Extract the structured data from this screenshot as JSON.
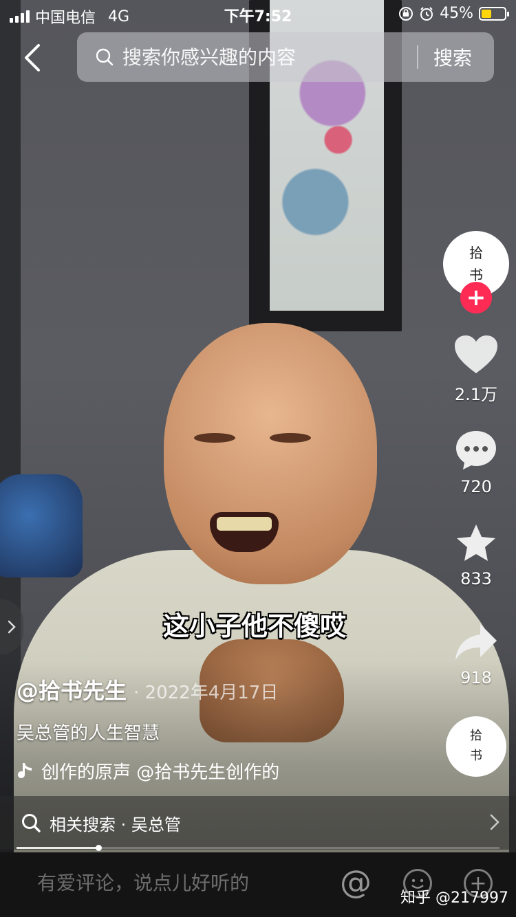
{
  "status_bar": {
    "carrier": "中国电信",
    "network": "4G",
    "time": "下午7:52",
    "battery_text": "45%",
    "battery_level": 0.45,
    "battery_color": "#ffd60a"
  },
  "search": {
    "placeholder": "搜索你感兴趣的内容",
    "button_label": "搜索"
  },
  "subtitle": "这小子他不傻哎",
  "author": {
    "avatar_text": [
      "拾",
      "书"
    ],
    "handle": "@拾书先生",
    "date": "· 2022年4月17日",
    "description": "吴总管的人生智慧"
  },
  "music": {
    "icon": "music-note-icon",
    "text": "创作的原声    @拾书先生创作的"
  },
  "actions": {
    "likes": "2.1万",
    "comments": "720",
    "favorites": "833",
    "shares": "918"
  },
  "disc_text": [
    "拾",
    "书"
  ],
  "related": {
    "text": "相关搜索 · 吴总管"
  },
  "progress": {
    "fraction": 0.17
  },
  "comment": {
    "placeholder": "有爱评论，说点儿好听的",
    "at_label": "@"
  },
  "watermark": "知乎 @217997",
  "colors": {
    "follow_accent": "#fe2c55",
    "battery": "#ffd60a"
  }
}
